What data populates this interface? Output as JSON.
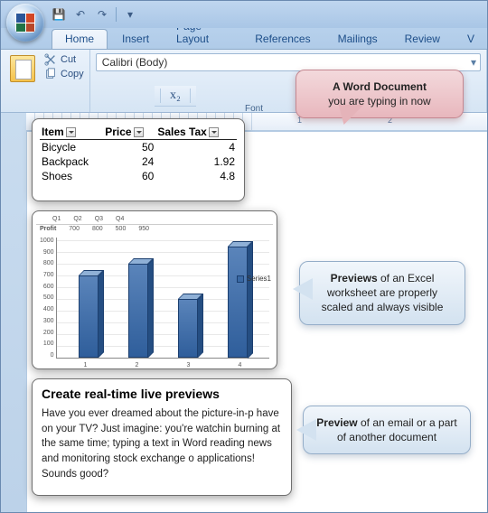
{
  "qat": {
    "save": "💾",
    "undo": "↶",
    "redo": "↷",
    "more": "▾"
  },
  "tabs": [
    "Home",
    "Insert",
    "Page Layout",
    "References",
    "Mailings",
    "Review",
    "V"
  ],
  "active_tab": 0,
  "clipboard": {
    "cut": "Cut",
    "copy": "Copy"
  },
  "font": {
    "name": "Calibri (Body)",
    "group_label": "Font",
    "x2": "x₂"
  },
  "ruler": {
    "n1": "1",
    "n2": "2"
  },
  "table": {
    "headers": [
      "Item",
      "Price",
      "Sales Tax"
    ],
    "rows": [
      {
        "item": "Bicycle",
        "price": "50",
        "tax": "4"
      },
      {
        "item": "Backpack",
        "price": "24",
        "tax": "1.92"
      },
      {
        "item": "Shoes",
        "price": "60",
        "tax": "4.8"
      }
    ]
  },
  "chart_data": {
    "type": "bar",
    "hdr_label": "Profit",
    "hdr_cols": [
      "Q1",
      "Q2",
      "Q3",
      "Q4"
    ],
    "hdr_vals": [
      "700",
      "800",
      "500",
      "950"
    ],
    "categories": [
      "1",
      "2",
      "3",
      "4"
    ],
    "values": [
      700,
      800,
      500,
      950
    ],
    "yticks": [
      "1000",
      "900",
      "800",
      "700",
      "600",
      "500",
      "400",
      "300",
      "200",
      "100",
      "0"
    ],
    "ylim": [
      0,
      1000
    ],
    "legend": "Series1"
  },
  "doc": {
    "title": "Create real-time live previews",
    "body": "Have you ever dreamed about the picture-in-p have on your TV? Just imagine: you're watchin burning at the same time; typing a text in Word reading news and monitoring stock exchange o applications! Sounds good?"
  },
  "callouts": {
    "c1_b": "A Word Document",
    "c1_t": "you are typing in now",
    "c2_b": "Previews",
    "c2_t": " of an Excel worksheet are properly scaled and always visible",
    "c3_b": "Preview",
    "c3_t": " of an email or a part of another document"
  }
}
